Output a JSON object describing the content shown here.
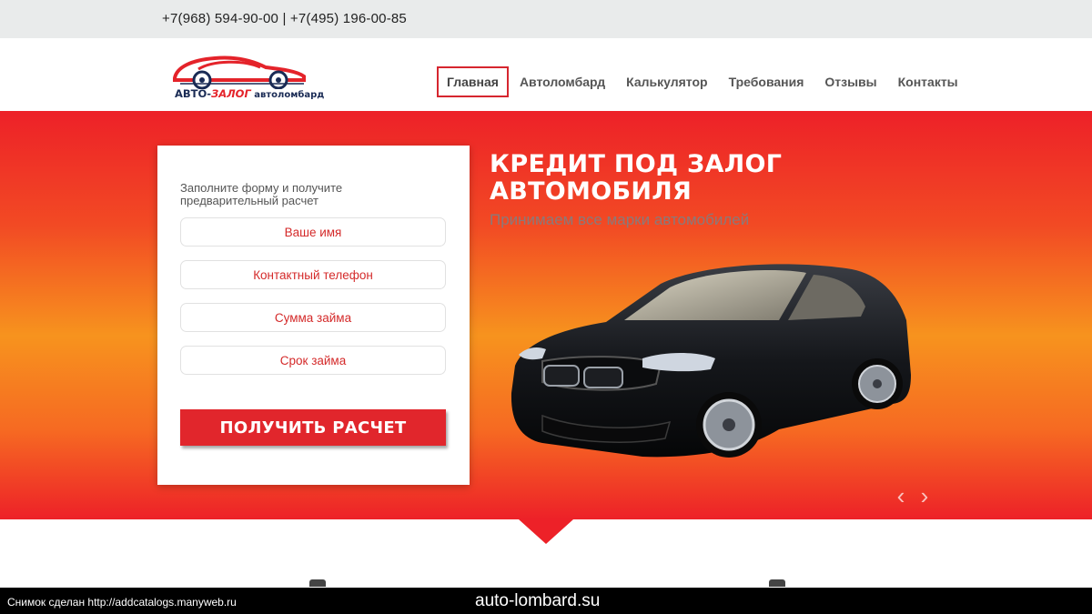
{
  "topbar": {
    "phones": "+7(968) 594-90-00 | +7(495) 196-00-85"
  },
  "logo": {
    "part1": "АВТО-",
    "part2": "ЗАЛОГ",
    "part3": " автоломбард"
  },
  "nav": {
    "items": [
      {
        "label": "Главная",
        "active": true
      },
      {
        "label": "Автоломбард",
        "active": false
      },
      {
        "label": "Калькулятор",
        "active": false
      },
      {
        "label": "Требования",
        "active": false
      },
      {
        "label": "Отзывы",
        "active": false
      },
      {
        "label": "Контакты",
        "active": false
      }
    ]
  },
  "form": {
    "intro": "Заполните форму и получите предварительный расчет",
    "fields": {
      "name": "Ваше имя",
      "phone": "Контактный телефон",
      "amount": "Сумма займа",
      "term": "Срок займа"
    },
    "submit_label": "Получить расчет"
  },
  "hero": {
    "title": "КРЕДИТ ПОД ЗАЛОГ АВТОМОБИЛЯ",
    "subtitle": "Принимаем все марки автомобилей"
  },
  "slider": {
    "prev": "‹",
    "next": "›"
  },
  "caption": {
    "left": "Снимок сделан http://addcatalogs.manyweb.ru",
    "center": "auto-lombard.su"
  },
  "colors": {
    "accent": "#e1262c",
    "navy": "#1a2b55"
  }
}
